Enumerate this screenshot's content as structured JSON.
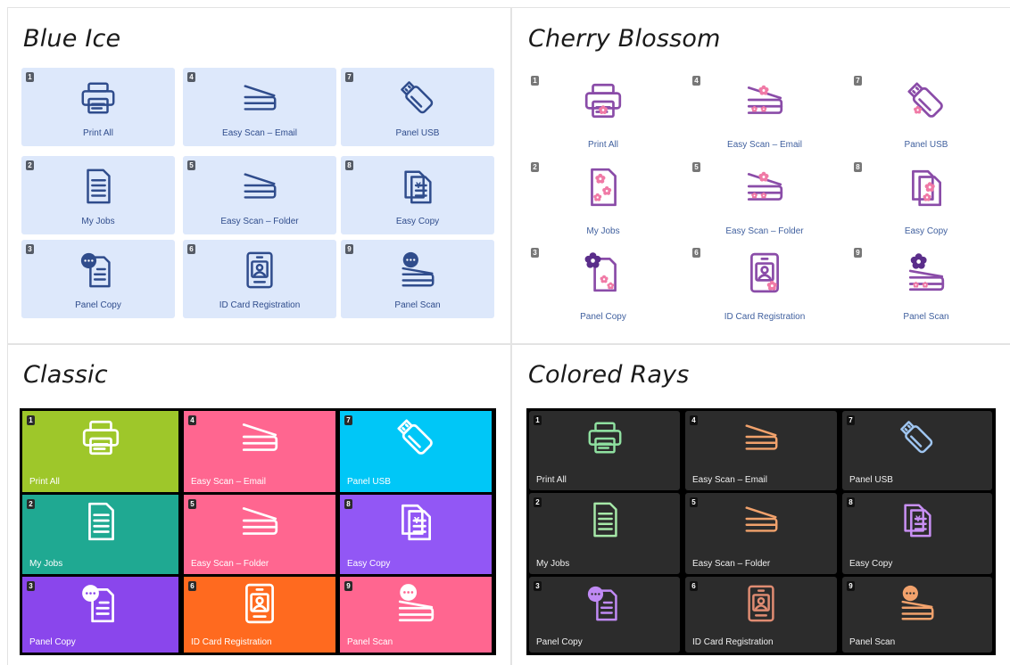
{
  "panels": [
    {
      "theme": "Blue Ice",
      "tiles": [
        {
          "number": "1",
          "label": "Print All",
          "icon": "printer-icon"
        },
        {
          "number": "2",
          "label": "My Jobs",
          "icon": "document-icon"
        },
        {
          "number": "3",
          "label": "Panel Copy",
          "icon": "panel-copy-icon"
        },
        {
          "number": "4",
          "label": "Easy Scan – Email",
          "icon": "scanner-icon"
        },
        {
          "number": "5",
          "label": "Easy Scan – Folder",
          "icon": "scanner-icon"
        },
        {
          "number": "6",
          "label": "ID Card Registration",
          "icon": "id-card-icon"
        },
        {
          "number": "7",
          "label": "Panel USB",
          "icon": "usb-drive-icon"
        },
        {
          "number": "8",
          "label": "Easy Copy",
          "icon": "copy-documents-icon"
        },
        {
          "number": "9",
          "label": "Panel Scan",
          "icon": "panel-scan-icon"
        }
      ]
    },
    {
      "theme": "Cherry Blossom",
      "tiles": [
        {
          "number": "1",
          "label": "Print All",
          "icon": "printer-icon"
        },
        {
          "number": "2",
          "label": "My Jobs",
          "icon": "document-icon"
        },
        {
          "number": "3",
          "label": "Panel Copy",
          "icon": "panel-copy-icon"
        },
        {
          "number": "4",
          "label": "Easy Scan – Email",
          "icon": "scanner-icon"
        },
        {
          "number": "5",
          "label": "Easy Scan – Folder",
          "icon": "scanner-icon"
        },
        {
          "number": "6",
          "label": "ID Card Registration",
          "icon": "id-card-icon"
        },
        {
          "number": "7",
          "label": "Panel USB",
          "icon": "usb-drive-icon"
        },
        {
          "number": "8",
          "label": "Easy Copy",
          "icon": "copy-documents-icon"
        },
        {
          "number": "9",
          "label": "Panel Scan",
          "icon": "panel-scan-icon"
        }
      ]
    },
    {
      "theme": "Classic",
      "tiles": [
        {
          "number": "1",
          "label": "Print All",
          "icon": "printer-icon"
        },
        {
          "number": "2",
          "label": "My Jobs",
          "icon": "document-icon"
        },
        {
          "number": "3",
          "label": "Panel Copy",
          "icon": "panel-copy-icon"
        },
        {
          "number": "4",
          "label": "Easy Scan – Email",
          "icon": "scanner-icon"
        },
        {
          "number": "5",
          "label": "Easy Scan – Folder",
          "icon": "scanner-icon"
        },
        {
          "number": "6",
          "label": "ID Card Registration",
          "icon": "id-card-icon"
        },
        {
          "number": "7",
          "label": "Panel USB",
          "icon": "usb-drive-icon"
        },
        {
          "number": "8",
          "label": "Easy Copy",
          "icon": "copy-documents-icon"
        },
        {
          "number": "9",
          "label": "Panel Scan",
          "icon": "panel-scan-icon"
        }
      ]
    },
    {
      "theme": "Colored Rays",
      "tiles": [
        {
          "number": "1",
          "label": "Print All",
          "icon": "printer-icon"
        },
        {
          "number": "2",
          "label": "My Jobs",
          "icon": "document-icon"
        },
        {
          "number": "3",
          "label": "Panel Copy",
          "icon": "panel-copy-icon"
        },
        {
          "number": "4",
          "label": "Easy Scan – Email",
          "icon": "scanner-icon"
        },
        {
          "number": "5",
          "label": "Easy Scan – Folder",
          "icon": "scanner-icon"
        },
        {
          "number": "6",
          "label": "ID Card Registration",
          "icon": "id-card-icon"
        },
        {
          "number": "7",
          "label": "Panel USB",
          "icon": "usb-drive-icon"
        },
        {
          "number": "8",
          "label": "Easy Copy",
          "icon": "copy-documents-icon"
        },
        {
          "number": "9",
          "label": "Panel Scan",
          "icon": "panel-scan-icon"
        }
      ]
    }
  ],
  "colors": {
    "blue_ice_tile": "#dde8fb",
    "blue_ice_icon": "#2f4c8c",
    "cherry_icon_outline": "#8a4ca8",
    "cherry_blossom": "#f07aa6",
    "classic_tiles": [
      "#9ec72a",
      "#1fa992",
      "#8a46ec",
      "#ff6690",
      "#ff6690",
      "#ff6a1f",
      "#00c7f7",
      "#9257f5",
      "#ff6690"
    ],
    "rays_icons": [
      "#8fe0a0",
      "#a6e8a8",
      "#c08af5",
      "#f2a26c",
      "#f2a26c",
      "#e08c72",
      "#9fc5f0",
      "#c990f5",
      "#f2a26c"
    ]
  }
}
